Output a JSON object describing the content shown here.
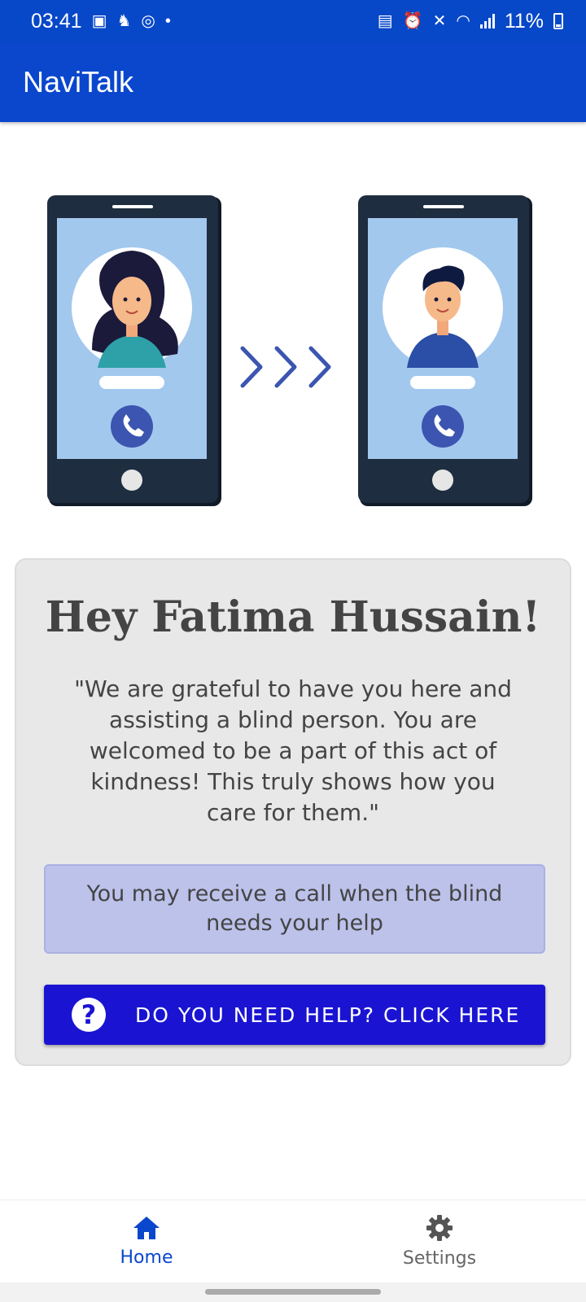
{
  "status_bar": {
    "time": "03:41",
    "battery": "11%"
  },
  "app": {
    "title": "NaviTalk"
  },
  "card": {
    "greeting": "Hey Fatima Hussain!",
    "quote": "\"We are grateful to have you here and assisting a blind person. You are welcomed to be a part of this act of kindness! This truly shows how you care for them.\"",
    "info": "You may receive a call when the blind needs your help",
    "help_button": "DO YOU NEED HELP? CLICK HERE",
    "help_icon_glyph": "?"
  },
  "bottom_nav": {
    "items": [
      {
        "label": "Home",
        "icon": "home-icon",
        "active": true
      },
      {
        "label": "Settings",
        "icon": "gear-icon",
        "active": false
      }
    ]
  },
  "colors": {
    "primary": "#0a47cd",
    "button": "#1a14d2",
    "info_bg": "#bcc2ea",
    "card_bg": "#e8e8e8",
    "phone_body": "#1f2d40",
    "phone_screen": "#a3c8ee",
    "call_icon": "#3b55b0"
  }
}
